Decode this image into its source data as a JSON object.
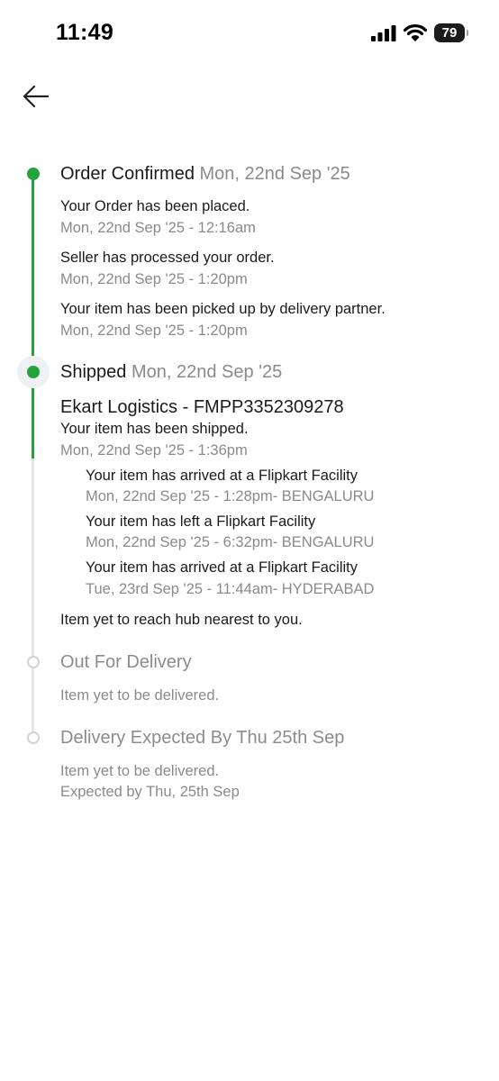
{
  "status_bar": {
    "time": "11:49",
    "battery": "79"
  },
  "stages": {
    "confirmed": {
      "title": "Order Confirmed",
      "date": "Mon, 22nd Sep '25",
      "events": [
        {
          "text": "Your Order has been placed.",
          "time": "Mon, 22nd Sep '25 - 12:16am"
        },
        {
          "text": "Seller has processed your order.",
          "time": "Mon, 22nd Sep '25 - 1:20pm"
        },
        {
          "text": "Your item has been picked up by delivery partner.",
          "time": "Mon, 22nd Sep '25 - 1:20pm"
        }
      ]
    },
    "shipped": {
      "title": "Shipped",
      "date": "Mon, 22nd Sep '25",
      "courier": "Ekart Logistics - FMPP3352309278",
      "event": {
        "text": "Your item has been shipped.",
        "time": "Mon, 22nd Sep '25 - 1:36pm"
      },
      "sub_events": [
        {
          "text": "Your item has arrived at a Flipkart Facility",
          "time": "Mon, 22nd Sep '25 - 1:28pm- BENGALURU"
        },
        {
          "text": "Your item has left a Flipkart Facility",
          "time": "Mon, 22nd Sep '25 - 6:32pm- BENGALURU"
        },
        {
          "text": "Your item has arrived at a Flipkart Facility",
          "time": "Tue, 23rd Sep '25 - 11:44am- HYDERABAD"
        }
      ],
      "note": "Item yet to reach hub nearest to you."
    },
    "out_for_delivery": {
      "title": "Out For Delivery",
      "note": "Item yet to be delivered."
    },
    "delivery_expected": {
      "title": "Delivery Expected By Thu 25th Sep",
      "note": "Item yet to be delivered.",
      "expected": "Expected by Thu, 25th Sep"
    }
  },
  "colors": {
    "accent": "#23a33c",
    "muted": "#8a8a8a",
    "rail_inactive": "#e6e6e6"
  }
}
